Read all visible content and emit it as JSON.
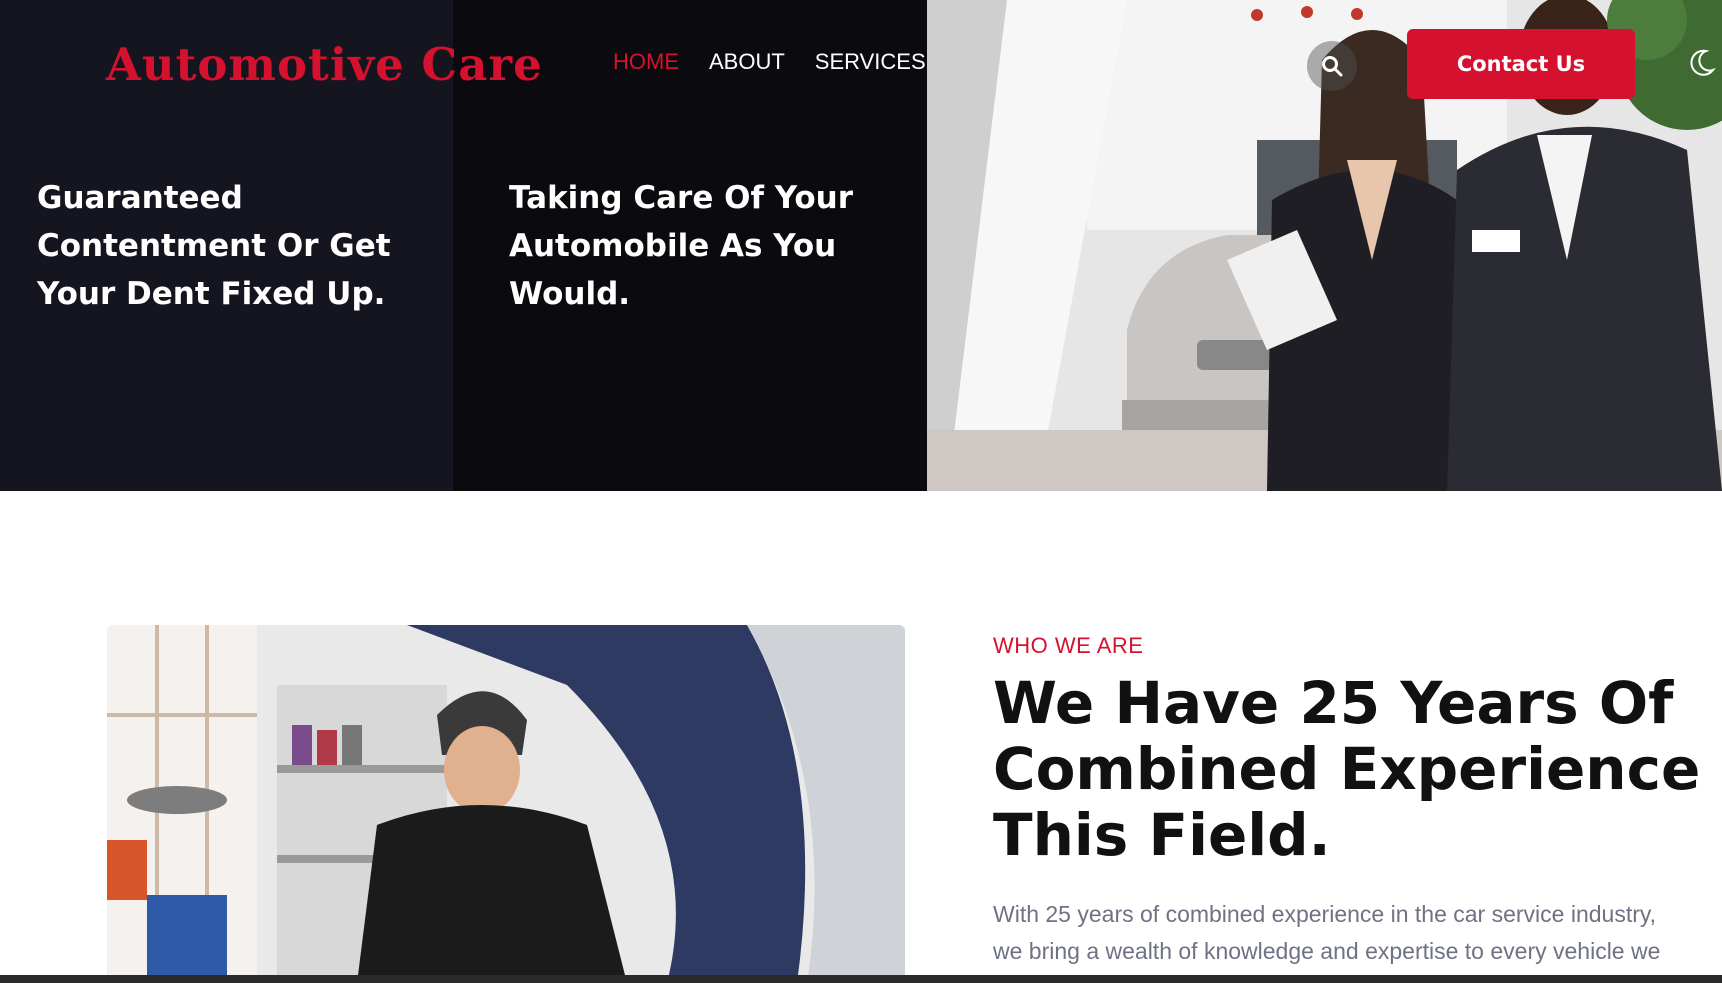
{
  "header": {
    "logo": "Automotive Care",
    "nav": [
      {
        "label": "HOME",
        "active": true
      },
      {
        "label": "ABOUT",
        "active": false
      },
      {
        "label": "SERVICES",
        "active": false
      }
    ],
    "contact_label": "Contact Us",
    "search_icon": "search-icon",
    "theme_icon": "moon-icon"
  },
  "hero": {
    "slide_a": "Guaranteed Contentment Or Get Your Dent Fixed Up.",
    "slide_b": "Taking Care Of Your Automobile As You Would."
  },
  "about": {
    "eyebrow": "WHO WE ARE",
    "title_line1": "We Have 25 Years Of",
    "title_line2": "Combined Experience In",
    "title_line3": "This Field.",
    "body_line1": "With 25 years of combined experience in the car service industry,",
    "body_line2": "we bring a wealth of knowledge and expertise to every vehicle we"
  },
  "colors": {
    "accent": "#d6112f",
    "dark_panel_a": "#15151f",
    "dark_panel_b": "#0b0a0f",
    "body_text": "#6f7284"
  }
}
